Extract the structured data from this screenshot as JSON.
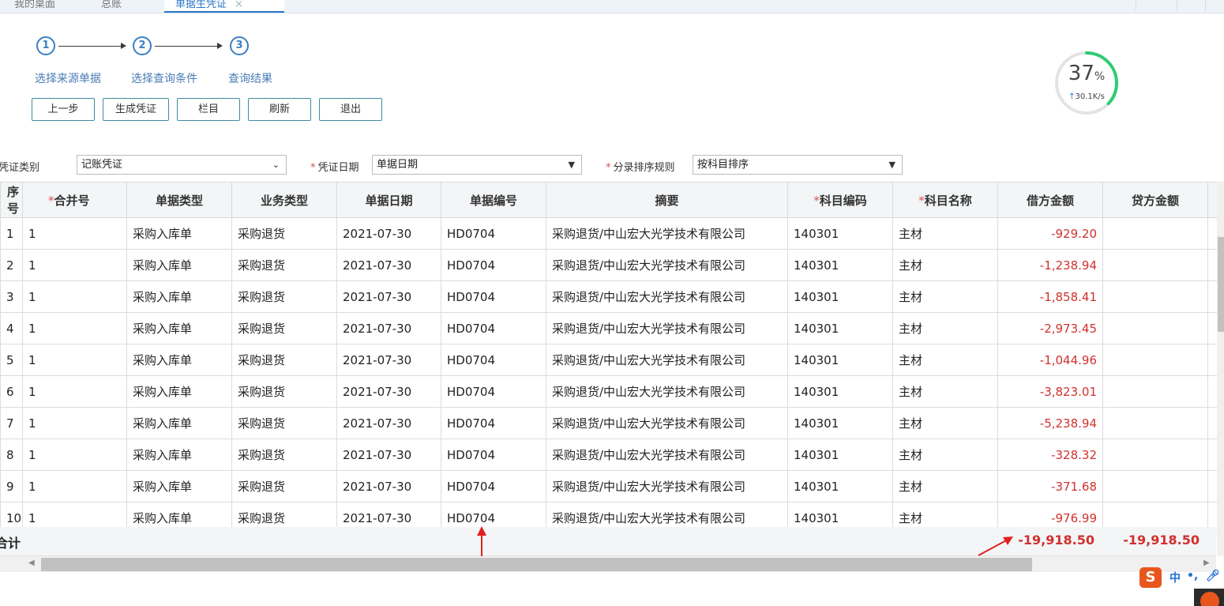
{
  "tabs": [
    {
      "label": "我的桌面"
    },
    {
      "label": "总账"
    },
    {
      "label": "单据生凭证",
      "close": "×"
    }
  ],
  "steps": [
    {
      "num": "1",
      "label": "选择来源单据"
    },
    {
      "num": "2",
      "label": "选择查询条件"
    },
    {
      "num": "3",
      "label": "查询结果"
    }
  ],
  "toolbar": {
    "prev": "上一步",
    "generate": "生成凭证",
    "columns": "栏目",
    "refresh": "刷新",
    "exit": "退出"
  },
  "net_gauge": {
    "percent": "37",
    "percent_sign": "%",
    "speed": "30.1K/s",
    "level": 0.37
  },
  "filters": {
    "voucher_type_label": "凭证类别",
    "voucher_type_value": "记账凭证",
    "voucher_date_label": "凭证日期",
    "voucher_date_value": "单据日期",
    "sort_rule_label": "分录排序规则",
    "sort_rule_value": "按科目排序"
  },
  "table": {
    "headers": [
      "序号",
      "合并号",
      "单据类型",
      "业务类型",
      "单据日期",
      "单据编号",
      "摘要",
      "科目编码",
      "科目名称",
      "借方金额",
      "贷方金额"
    ],
    "rows": [
      [
        "1",
        "1",
        "采购入库单",
        "采购退货",
        "2021-07-30",
        "HD0704",
        "采购退货/中山宏大光学技术有限公司",
        "140301",
        "主材",
        "-929.20",
        ""
      ],
      [
        "2",
        "1",
        "采购入库单",
        "采购退货",
        "2021-07-30",
        "HD0704",
        "采购退货/中山宏大光学技术有限公司",
        "140301",
        "主材",
        "-1,238.94",
        ""
      ],
      [
        "3",
        "1",
        "采购入库单",
        "采购退货",
        "2021-07-30",
        "HD0704",
        "采购退货/中山宏大光学技术有限公司",
        "140301",
        "主材",
        "-1,858.41",
        ""
      ],
      [
        "4",
        "1",
        "采购入库单",
        "采购退货",
        "2021-07-30",
        "HD0704",
        "采购退货/中山宏大光学技术有限公司",
        "140301",
        "主材",
        "-2,973.45",
        ""
      ],
      [
        "5",
        "1",
        "采购入库单",
        "采购退货",
        "2021-07-30",
        "HD0704",
        "采购退货/中山宏大光学技术有限公司",
        "140301",
        "主材",
        "-1,044.96",
        ""
      ],
      [
        "6",
        "1",
        "采购入库单",
        "采购退货",
        "2021-07-30",
        "HD0704",
        "采购退货/中山宏大光学技术有限公司",
        "140301",
        "主材",
        "-3,823.01",
        ""
      ],
      [
        "7",
        "1",
        "采购入库单",
        "采购退货",
        "2021-07-30",
        "HD0704",
        "采购退货/中山宏大光学技术有限公司",
        "140301",
        "主材",
        "-5,238.94",
        ""
      ],
      [
        "8",
        "1",
        "采购入库单",
        "采购退货",
        "2021-07-30",
        "HD0704",
        "采购退货/中山宏大光学技术有限公司",
        "140301",
        "主材",
        "-328.32",
        ""
      ],
      [
        "9",
        "1",
        "采购入库单",
        "采购退货",
        "2021-07-30",
        "HD0704",
        "采购退货/中山宏大光学技术有限公司",
        "140301",
        "主材",
        "-371.68",
        ""
      ],
      [
        "10",
        "1",
        "采购入库单",
        "采购退货",
        "2021-07-30",
        "HD0704",
        "采购退货/中山宏大光学技术有限公司",
        "140301",
        "主材",
        "-976.99",
        ""
      ]
    ],
    "total_label": "合计",
    "total_debit": "-19,918.50",
    "total_credit": "-19,918.50"
  },
  "ime": {
    "logo": "S",
    "mode": "中"
  },
  "colors": {
    "accent": "#3a7fc0",
    "negative": "#d0312d",
    "button_border": "#3d8d9e",
    "gauge": "#2ecc71"
  }
}
